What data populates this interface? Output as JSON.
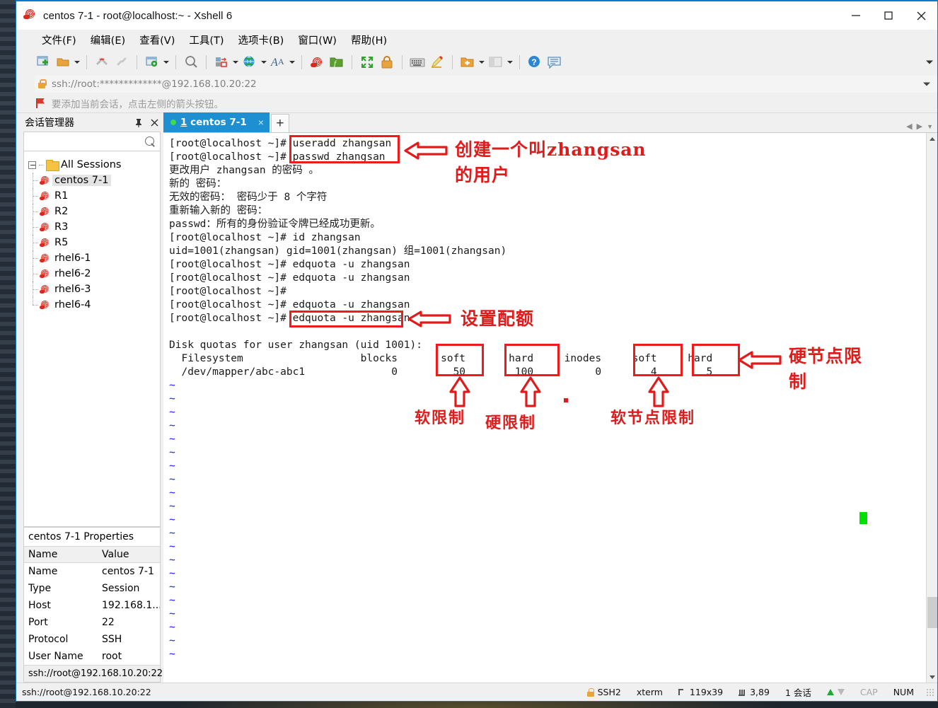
{
  "window": {
    "title": "centos 7-1 - root@localhost:~ - Xshell 6",
    "app_icon": "snail-icon",
    "controls": {
      "minimize": "minimize-icon",
      "maximize": "maximize-icon",
      "close": "close-icon"
    }
  },
  "menu": {
    "items": [
      {
        "label": "文件(F)",
        "name": "menu-file"
      },
      {
        "label": "编辑(E)",
        "name": "menu-edit"
      },
      {
        "label": "查看(V)",
        "name": "menu-view"
      },
      {
        "label": "工具(T)",
        "name": "menu-tools"
      },
      {
        "label": "选项卡(B)",
        "name": "menu-tabs"
      },
      {
        "label": "窗口(W)",
        "name": "menu-window"
      },
      {
        "label": "帮助(H)",
        "name": "menu-help"
      }
    ]
  },
  "toolbar": {
    "icons": [
      "new-session-icon",
      "open-folder-icon",
      "disconnect-icon",
      "reconnect-icon",
      "session-properties-icon",
      "find-icon",
      "transfer-icon",
      "globe-icon",
      "font-icon",
      "xshell-icon",
      "xftp-icon",
      "fullscreen-icon",
      "lock-icon",
      "keyboard-icon",
      "highlight-icon",
      "add-folder-icon",
      "layout-icon",
      "help-icon",
      "feedback-icon"
    ],
    "overflow": "toolbar-overflow-icon"
  },
  "address": {
    "value": "ssh://root:*************@192.168.10.20:22",
    "lock": "lock-icon",
    "dropdown": "chevron-down-icon"
  },
  "tip": {
    "icon": "flag-icon",
    "text": "要添加当前会话，点击左侧的箭头按钮。"
  },
  "sidebar": {
    "title": "会话管理器",
    "pin": "pin-icon",
    "close": "close-icon",
    "search": {
      "placeholder": "",
      "value": "",
      "icon": "search-icon"
    },
    "tree_root": "All Sessions",
    "items": [
      {
        "label": "centos 7-1",
        "selected": true
      },
      {
        "label": "R1",
        "selected": false
      },
      {
        "label": "R2",
        "selected": false
      },
      {
        "label": "R3",
        "selected": false
      },
      {
        "label": "R5",
        "selected": false
      },
      {
        "label": "rhel6-1",
        "selected": false
      },
      {
        "label": "rhel6-2",
        "selected": false
      },
      {
        "label": "rhel6-3",
        "selected": false
      },
      {
        "label": "rhel6-4",
        "selected": false
      }
    ]
  },
  "properties": {
    "title": "centos 7-1 Properties",
    "headers": [
      "Name",
      "Value"
    ],
    "rows": [
      {
        "name": "Name",
        "value": "centos 7-1"
      },
      {
        "name": "Type",
        "value": "Session"
      },
      {
        "name": "Host",
        "value": "192.168.1..."
      },
      {
        "name": "Port",
        "value": "22"
      },
      {
        "name": "Protocol",
        "value": "SSH"
      },
      {
        "name": "User Name",
        "value": "root"
      }
    ],
    "footer": "ssh://root@192.168.10.20:22"
  },
  "tabs": {
    "active": {
      "index": "1",
      "label": "centos 7-1",
      "status": "connected",
      "close": "close-icon"
    },
    "new_tab": "+"
  },
  "terminal": {
    "lines": [
      {
        "text": "[root@localhost ~]# useradd zhangsan",
        "color": "black"
      },
      {
        "text": "[root@localhost ~]# passwd zhangsan",
        "color": "black"
      },
      {
        "text": "更改用户 zhangsan 的密码 。",
        "color": "black"
      },
      {
        "text": "新的 密码：",
        "color": "black"
      },
      {
        "text": "无效的密码： 密码少于 8 个字符",
        "color": "black"
      },
      {
        "text": "重新输入新的 密码：",
        "color": "black"
      },
      {
        "text": "passwd：所有的身份验证令牌已经成功更新。",
        "color": "black"
      },
      {
        "text": "[root@localhost ~]# id zhangsan",
        "color": "black"
      },
      {
        "text": "uid=1001(zhangsan) gid=1001(zhangsan) 组=1001(zhangsan)",
        "color": "black"
      },
      {
        "text": "[root@localhost ~]# edquota -u zhangsan",
        "color": "black"
      },
      {
        "text": "[root@localhost ~]# edquota -u zhangsan",
        "color": "black"
      },
      {
        "text": "[root@localhost ~]#",
        "color": "black"
      },
      {
        "text": "[root@localhost ~]# edquota -u zhangsan",
        "color": "black"
      },
      {
        "text": "[root@localhost ~]# edquota -u zhangsan",
        "color": "black"
      },
      {
        "text": "",
        "color": "black"
      },
      {
        "text": "Disk quotas for user zhangsan (uid 1001):",
        "color": "black"
      },
      {
        "text": "  Filesystem                   blocks       soft       hard     inodes     soft     hard",
        "color": "black"
      },
      {
        "text": "  /dev/mapper/abc-abc1              0         50        100          0        4        5",
        "color": "black"
      }
    ],
    "tilde_count": 21,
    "tilde_char": "~",
    "tilde_color": "#1414ff"
  },
  "annotations": [
    {
      "name": "annotation-create-user",
      "text": "创建一个叫zhangsan\n的用户"
    },
    {
      "name": "annotation-set-quota",
      "text": "设置配额"
    },
    {
      "name": "annotation-soft-limit",
      "text": "软限制"
    },
    {
      "name": "annotation-hard-limit",
      "text": "硬限制"
    },
    {
      "name": "annotation-soft-inode-limit",
      "text": "软节点限制"
    },
    {
      "name": "annotation-hard-inode-limit",
      "text": "硬节点限\n制"
    }
  ],
  "quota_table": {
    "header": "Disk quotas for user zhangsan (uid 1001):",
    "columns": [
      "Filesystem",
      "blocks",
      "soft",
      "hard",
      "inodes",
      "soft",
      "hard"
    ],
    "row": [
      "/dev/mapper/abc-abc1",
      "0",
      "50",
      "100",
      "0",
      "4",
      "5"
    ]
  },
  "statusbar": {
    "left": "ssh://root@192.168.10.20:22",
    "protocol": "SSH2",
    "emulation": "xterm",
    "size": "119x39",
    "position": "3,89",
    "sessions": "1 会话",
    "cap": "CAP",
    "num": "NUM"
  },
  "colors": {
    "accent": "#1e90d2",
    "annotation": "#ef1b1b",
    "terminal_blue": "#1414ff",
    "cursor_green": "#00e000"
  }
}
